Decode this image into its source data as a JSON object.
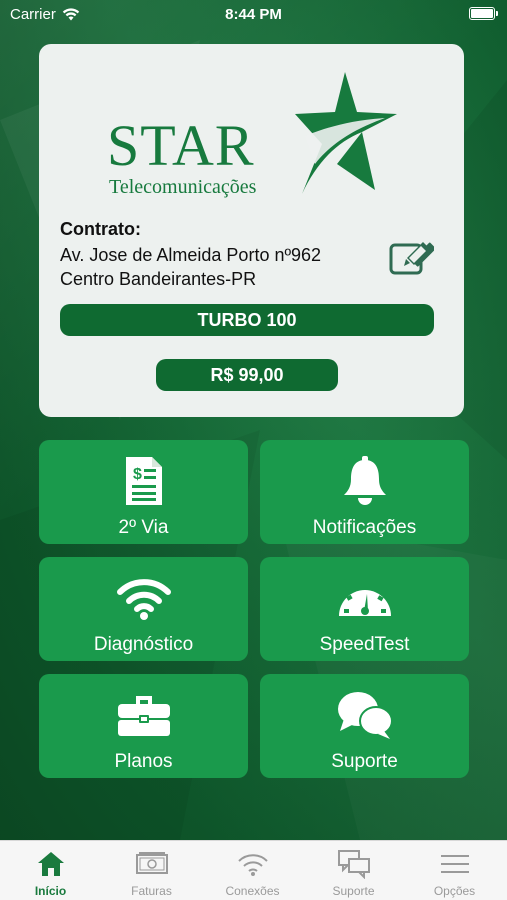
{
  "status_bar": {
    "carrier": "Carrier",
    "time": "8:44 PM",
    "battery_level": 1.0
  },
  "logo": {
    "name": "STAR",
    "subtitle": "Telecomunicações"
  },
  "contract": {
    "label": "Contrato:",
    "address_line1": "Av. Jose de Almeida Porto nº962",
    "address_line2": "Centro Bandeirantes-PR",
    "plan": "TURBO 100",
    "price": "R$ 99,00"
  },
  "tiles": [
    {
      "label": "2º Via",
      "icon": "invoice-document-icon"
    },
    {
      "label": "Notificações",
      "icon": "bell-icon"
    },
    {
      "label": "Diagnóstico",
      "icon": "wifi-icon"
    },
    {
      "label": "SpeedTest",
      "icon": "speedometer-icon"
    },
    {
      "label": "Planos",
      "icon": "briefcase-icon"
    },
    {
      "label": "Suporte",
      "icon": "chat-bubbles-icon"
    }
  ],
  "tab_bar": [
    {
      "label": "Início",
      "icon": "home-icon",
      "active": true
    },
    {
      "label": "Faturas",
      "icon": "money-icon",
      "active": false
    },
    {
      "label": "Conexões",
      "icon": "wifi-icon",
      "active": false
    },
    {
      "label": "Suporte",
      "icon": "chat-icon",
      "active": false
    },
    {
      "label": "Opções",
      "icon": "menu-icon",
      "active": false
    }
  ],
  "colors": {
    "background": "#126a35",
    "card": "#edf1ef",
    "brand_green": "#177a3e",
    "button_dark": "#0f6a31",
    "tile": "#1a9a4c",
    "tab_active": "#1a7a3e"
  }
}
